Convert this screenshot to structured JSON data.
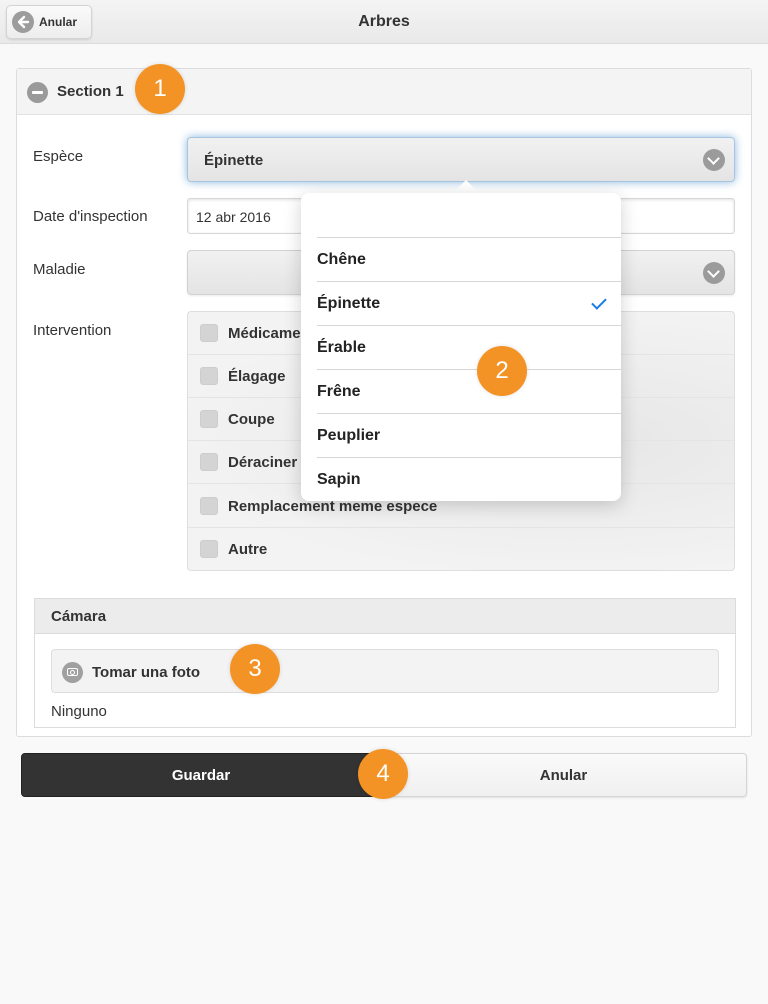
{
  "header": {
    "title": "Arbres",
    "back_label": "Anular"
  },
  "section": {
    "title": "Section 1"
  },
  "fields": {
    "espece_label": "Espèce",
    "espece_value": "Épinette",
    "date_label": "Date d'inspection",
    "date_value": "12 abr 2016",
    "maladie_label": "Maladie",
    "maladie_value": "",
    "intervention_label": "Intervention"
  },
  "interventions": [
    "Médicament",
    "Élagage",
    "Coupe",
    "Déraciner",
    "Remplacement meme espece",
    "Autre"
  ],
  "camera": {
    "title": "Cámara",
    "take_photo_label": "Tomar una foto",
    "none_label": "Ninguno"
  },
  "actions": {
    "save_label": "Guardar",
    "cancel_label": "Anular"
  },
  "popover": {
    "options": [
      "Chêne",
      "Épinette",
      "Érable",
      "Frêne",
      "Peuplier",
      "Sapin"
    ],
    "selected": "Épinette"
  },
  "callouts": [
    "1",
    "2",
    "3",
    "4"
  ],
  "colors": {
    "callout": "#f39325",
    "primary_button": "#333333",
    "check_accent": "#1d7ce0"
  }
}
